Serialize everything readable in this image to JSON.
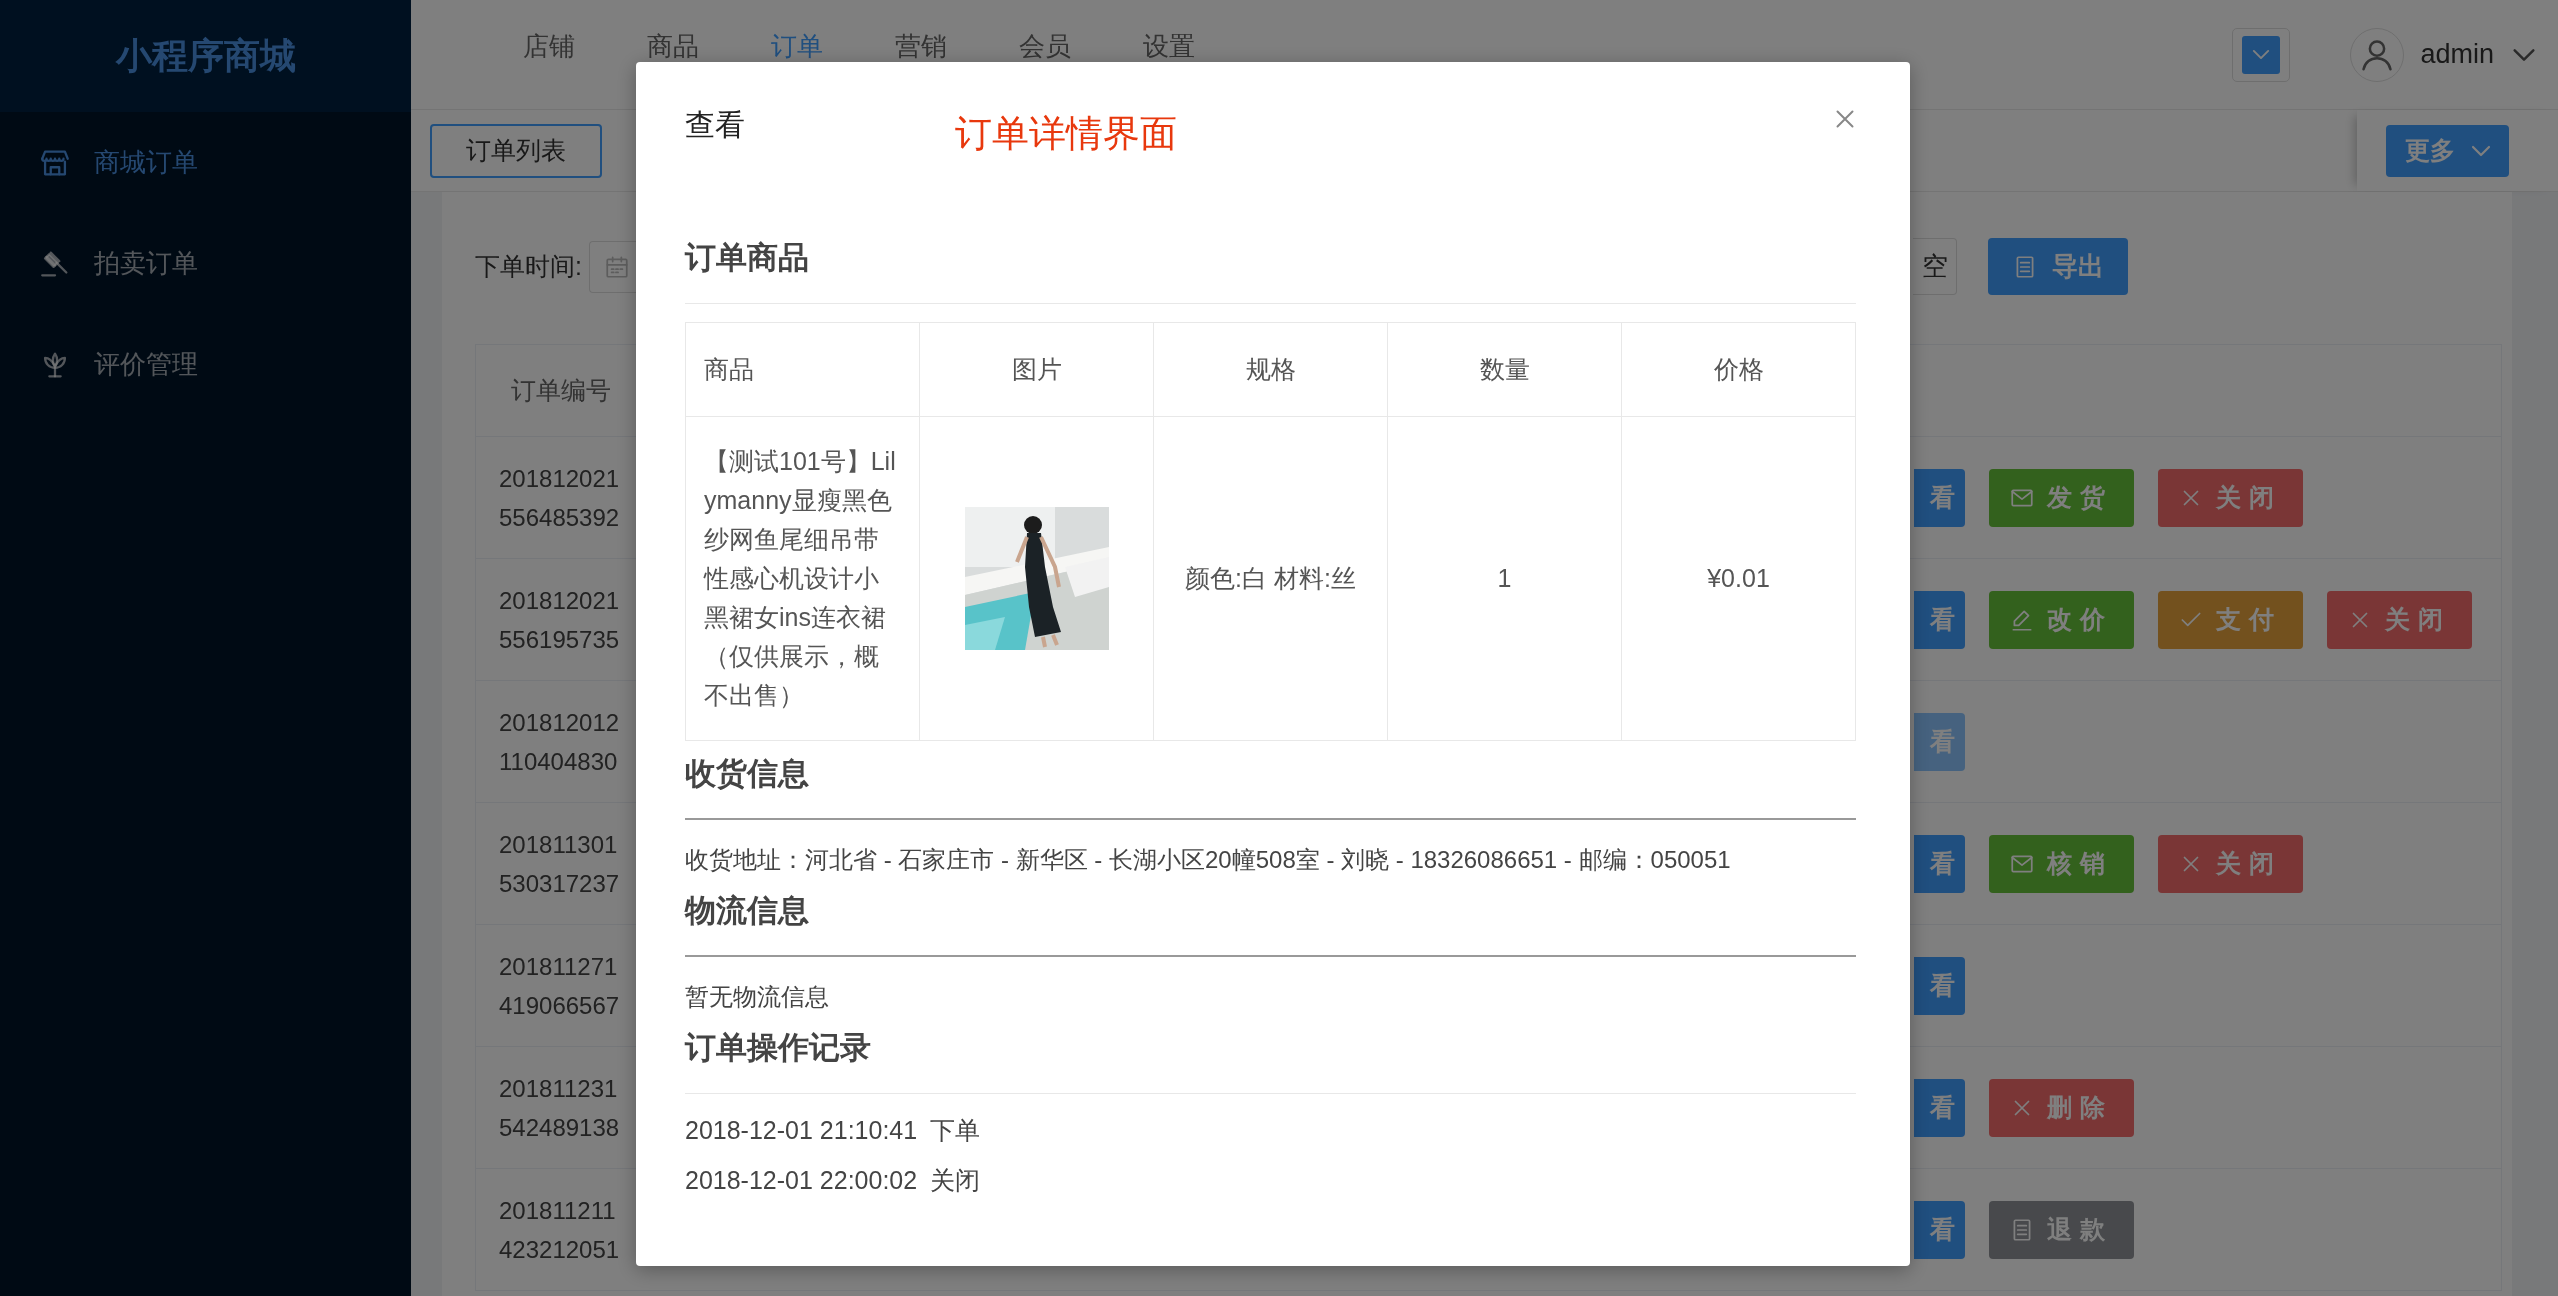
{
  "sidebar": {
    "logo": "小程序商城",
    "items": [
      {
        "label": "商城订单",
        "selected": true
      },
      {
        "label": "拍卖订单",
        "selected": false
      },
      {
        "label": "评价管理",
        "selected": false
      }
    ]
  },
  "top_nav": {
    "items": [
      {
        "label": "店铺",
        "selected": false
      },
      {
        "label": "商品",
        "selected": false
      },
      {
        "label": "订单",
        "selected": true
      },
      {
        "label": "营销",
        "selected": false
      },
      {
        "label": "会员",
        "selected": false
      },
      {
        "label": "设置",
        "selected": false
      }
    ],
    "user": "admin"
  },
  "toolbar": {
    "tab": "订单列表",
    "more_button": "更多"
  },
  "filter": {
    "date_label": "下单时间:",
    "clear_button": "空",
    "export_button": "导出"
  },
  "orders": {
    "columns": [
      "订单编号"
    ],
    "rows": [
      {
        "order_no": "201812021556485392",
        "view_button": {
          "label": "看",
          "highlighted": false
        },
        "actions": [
          {
            "label": "发货",
            "kind": "ship"
          },
          {
            "label": "关闭",
            "kind": "close"
          }
        ]
      },
      {
        "order_no": "201812021556195735",
        "view_button": {
          "label": "看",
          "highlighted": false
        },
        "actions": [
          {
            "label": "改价",
            "kind": "edit_price"
          },
          {
            "label": "支付",
            "kind": "pay"
          },
          {
            "label": "关闭",
            "kind": "close"
          }
        ]
      },
      {
        "order_no": "201812012110404830",
        "view_button": {
          "label": "看",
          "highlighted": true
        },
        "actions": []
      },
      {
        "order_no": "201811301530317237",
        "view_button": {
          "label": "看",
          "highlighted": false
        },
        "actions": [
          {
            "label": "核销",
            "kind": "verify"
          },
          {
            "label": "关闭",
            "kind": "close"
          }
        ]
      },
      {
        "order_no": "201811271419066567",
        "view_button": {
          "label": "看",
          "highlighted": false
        },
        "actions": []
      },
      {
        "order_no": "201811231542489138",
        "view_button": {
          "label": "看",
          "highlighted": false
        },
        "actions": [
          {
            "label": "删除",
            "kind": "delete"
          }
        ]
      },
      {
        "order_no": "201811211423212051",
        "view_button": {
          "label": "看",
          "highlighted": false
        },
        "actions": [
          {
            "label": "退款",
            "kind": "refund"
          }
        ]
      }
    ]
  },
  "modal": {
    "title": "查看",
    "annotation": "订单详情界面",
    "goods": {
      "heading": "订单商品",
      "columns": [
        "商品",
        "图片",
        "规格",
        "数量",
        "价格"
      ],
      "rows": [
        {
          "name": "【测试101号】Lilymanny显瘦黑色纱网鱼尾细吊带性感心机设计小黑裙女ins连衣裙（仅供展示，概不出售）",
          "spec": "颜色:白 材料:丝",
          "quantity": "1",
          "price": "¥0.01"
        }
      ]
    },
    "shipping": {
      "heading": "收货信息",
      "address": "收货地址：河北省 - 石家庄市 - 新华区 - 长湖小区20幢508室 - 刘晓 - 18326086651 - 邮编：050051"
    },
    "logistics": {
      "heading": "物流信息",
      "text": "暂无物流信息"
    },
    "log": {
      "heading": "订单操作记录",
      "entries": [
        {
          "time": "2018-12-01 21:10:41",
          "action": "下单"
        },
        {
          "time": "2018-12-01 22:00:02",
          "action": "关闭"
        }
      ]
    }
  }
}
